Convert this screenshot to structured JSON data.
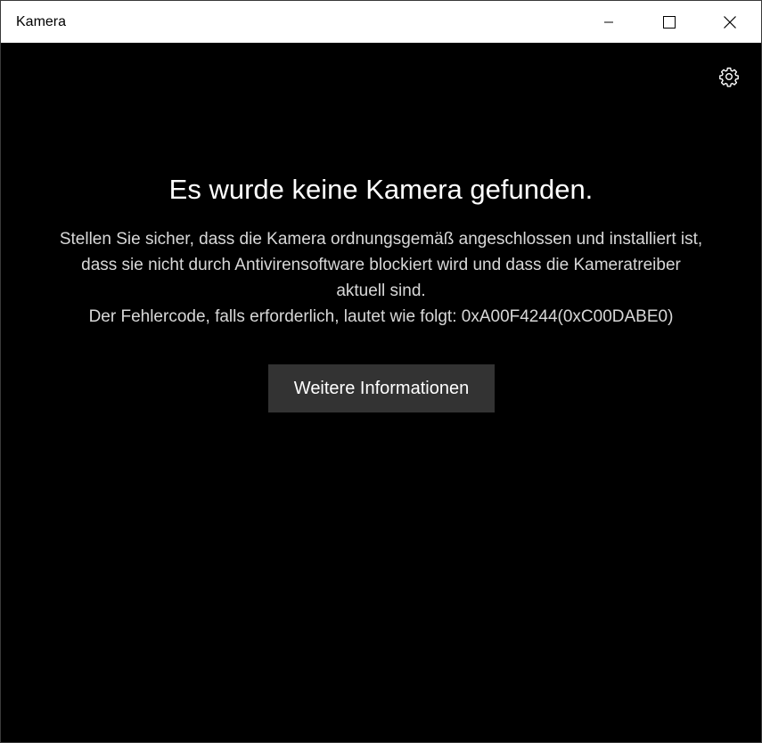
{
  "window": {
    "title": "Kamera",
    "minimize_icon": "minimize-icon",
    "maximize_icon": "maximize-icon",
    "close_icon": "close-icon"
  },
  "toolbar": {
    "settings_icon": "gear-icon"
  },
  "error": {
    "heading": "Es wurde keine Kamera gefunden.",
    "lines": [
      "Stellen Sie sicher, dass die Kamera ordnungsgemäß angeschlossen und installiert ist,",
      "dass sie nicht durch Antivirensoftware blockiert wird und dass die Kameratreiber",
      "aktuell sind.",
      "Der Fehlercode, falls erforderlich, lautet wie folgt: 0xA00F4244(0xC00DABE0)"
    ],
    "more_info_label": "Weitere Informationen"
  },
  "colors": {
    "background": "#000000",
    "titlebar": "#ffffff",
    "button": "#333333",
    "text": "#ffffff",
    "secondary_text": "#d8d8d8"
  }
}
